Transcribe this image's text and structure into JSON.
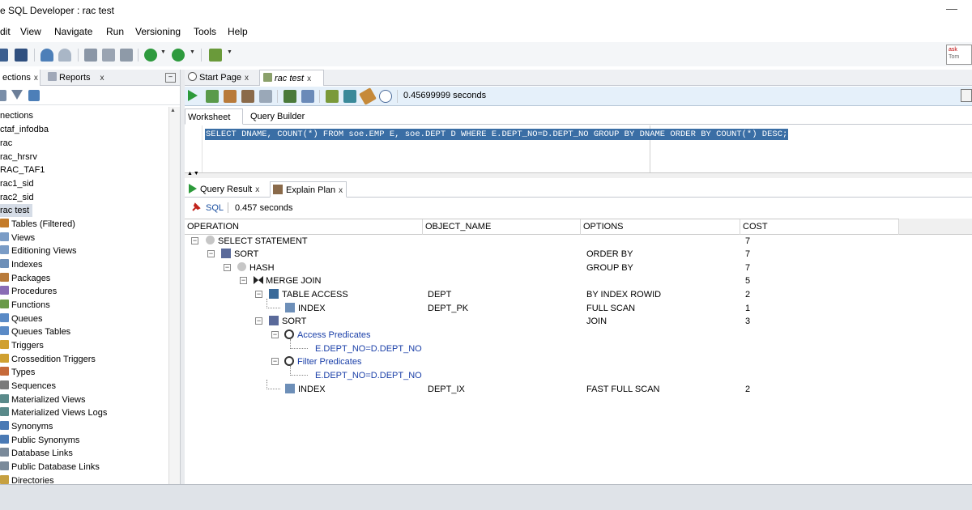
{
  "window": {
    "title": "e SQL Developer : rac test",
    "minimize_glyph": "—"
  },
  "menu": [
    "dit",
    "View",
    "Navigate",
    "Run",
    "Versioning",
    "Tools",
    "Help"
  ],
  "toolbar_icons": [
    "save-icon",
    "save-all-icon",
    "undo-icon",
    "redo-icon",
    "cut-icon",
    "copy-icon",
    "paste-icon",
    "back-icon",
    "forward-icon",
    "connection-icon"
  ],
  "ask_logo": {
    "line1": "ask",
    "line2": "Tom"
  },
  "left_panel": {
    "tabs": [
      {
        "label": "ections",
        "close": "x"
      },
      {
        "label": "Reports",
        "close": "x"
      }
    ],
    "minimize": "–",
    "tree": [
      {
        "label": "nections"
      },
      {
        "label": "ctaf_infodba"
      },
      {
        "label": "rac"
      },
      {
        "label": "rac_hrsrv"
      },
      {
        "label": "RAC_TAF1"
      },
      {
        "label": "rac1_sid"
      },
      {
        "label": "rac2_sid"
      },
      {
        "label": "rac test",
        "selected": true
      },
      {
        "label": "Tables (Filtered)",
        "color": "#c47b2a"
      },
      {
        "label": "Views",
        "color": "#7a9cc6"
      },
      {
        "label": "Editioning Views",
        "color": "#7a9cc6"
      },
      {
        "label": "Indexes",
        "color": "#6d8fb8"
      },
      {
        "label": "Packages",
        "color": "#b87a3a"
      },
      {
        "label": "Procedures",
        "color": "#8a6cb5"
      },
      {
        "label": "Functions",
        "color": "#6a9a4a"
      },
      {
        "label": "Queues",
        "color": "#5a8ac6"
      },
      {
        "label": "Queues Tables",
        "color": "#5a8ac6"
      },
      {
        "label": "Triggers",
        "color": "#d0a030"
      },
      {
        "label": "Crossedition Triggers",
        "color": "#d0a030"
      },
      {
        "label": "Types",
        "color": "#c66a3a"
      },
      {
        "label": "Sequences",
        "color": "#7a7a7a"
      },
      {
        "label": "Materialized Views",
        "color": "#5a8a8a"
      },
      {
        "label": "Materialized Views Logs",
        "color": "#5a8a8a"
      },
      {
        "label": "Synonyms",
        "color": "#4a7ab5"
      },
      {
        "label": "Public Synonyms",
        "color": "#4a7ab5"
      },
      {
        "label": "Database Links",
        "color": "#7a8a9a"
      },
      {
        "label": "Public Database Links",
        "color": "#7a8a9a"
      },
      {
        "label": "Directories",
        "color": "#c6a040"
      }
    ]
  },
  "editor": {
    "tabs": [
      {
        "label": "Start Page",
        "close": "x"
      },
      {
        "label": "rac test",
        "close": "x"
      }
    ],
    "elapsed": "0.45699999 seconds",
    "worksheet_tabs": [
      "Worksheet",
      "Query Builder"
    ],
    "sql": "SELECT DNAME, COUNT(*) FROM soe.EMP E, soe.DEPT D WHERE E.DEPT_NO=D.DEPT_NO GROUP BY DNAME ORDER BY COUNT(*) DESC;"
  },
  "results": {
    "tabs": [
      {
        "label": "Query Result",
        "close": "x"
      },
      {
        "label": "Explain Plan",
        "close": "x"
      }
    ],
    "sql_link": "SQL",
    "time": "0.457 seconds",
    "columns": [
      "OPERATION",
      "OBJECT_NAME",
      "OPTIONS",
      "COST"
    ],
    "rows": [
      {
        "operation": "SELECT STATEMENT",
        "object": "",
        "options": "",
        "cost": "7"
      },
      {
        "operation": "SORT",
        "object": "",
        "options": "ORDER BY",
        "cost": "7"
      },
      {
        "operation": "HASH",
        "object": "",
        "options": "GROUP BY",
        "cost": "7"
      },
      {
        "operation": "MERGE JOIN",
        "object": "",
        "options": "",
        "cost": "5"
      },
      {
        "operation": "TABLE ACCESS",
        "object": "DEPT",
        "options": "BY INDEX ROWID",
        "cost": "2"
      },
      {
        "operation": "INDEX",
        "object": "DEPT_PK",
        "options": "FULL SCAN",
        "cost": "1"
      },
      {
        "operation": "SORT",
        "object": "",
        "options": "JOIN",
        "cost": "3"
      },
      {
        "operation": "Access Predicates",
        "object": "",
        "options": "",
        "cost": ""
      },
      {
        "operation": "E.DEPT_NO=D.DEPT_NO",
        "object": "",
        "options": "",
        "cost": ""
      },
      {
        "operation": "Filter Predicates",
        "object": "",
        "options": "",
        "cost": ""
      },
      {
        "operation": "E.DEPT_NO=D.DEPT_NO",
        "object": "",
        "options": "",
        "cost": ""
      },
      {
        "operation": "INDEX",
        "object": "DEPT_IX",
        "options": "FAST FULL SCAN",
        "cost": "2"
      }
    ]
  }
}
